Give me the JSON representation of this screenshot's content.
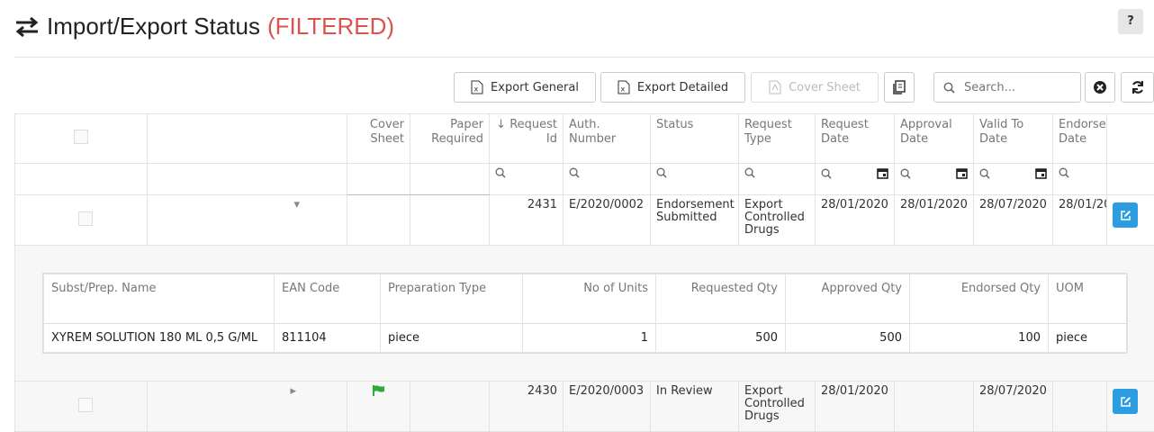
{
  "header": {
    "title": "Import/Export Status",
    "filter_label": "(FILTERED)",
    "help_label": "?"
  },
  "toolbar": {
    "export_general": "Export General",
    "export_detailed": "Export Detailed",
    "cover_sheet": "Cover Sheet",
    "search_placeholder": "Search..."
  },
  "columns": {
    "cover_sheet": "Cover Sheet",
    "paper_required": "Paper Required",
    "request_id": "Request Id",
    "auth_number": "Auth. Number",
    "status": "Status",
    "request_type": "Request Type",
    "request_date": "Request Date",
    "approval_date": "Approval Date",
    "valid_to_date": "Valid To Date",
    "endorsement_date": "Endorsen Date"
  },
  "rows": [
    {
      "request_id": "2431",
      "auth_number": "E/2020/0002",
      "status": "Endorsement Submitted",
      "request_type": "Export Controlled Drugs",
      "request_date": "28/01/2020",
      "approval_date": "28/01/2020",
      "valid_to_date": "28/07/2020",
      "endorsement_date": "28/01/20"
    },
    {
      "request_id": "2430",
      "auth_number": "E/2020/0003",
      "status": "In Review",
      "request_type": "Export Controlled Drugs",
      "request_date": "28/01/2020",
      "approval_date": "",
      "valid_to_date": "28/07/2020",
      "endorsement_date": ""
    }
  ],
  "detail": {
    "headers": {
      "name": "Subst/Prep. Name",
      "ean": "EAN Code",
      "prep_type": "Preparation Type",
      "units": "No of Units",
      "requested": "Requested Qty",
      "approved": "Approved Qty",
      "endorsed": "Endorsed Qty",
      "uom": "UOM"
    },
    "items": [
      {
        "name": "XYREM SOLUTION 180 ML 0,5 G/ML",
        "ean": "811104",
        "prep_type": "piece",
        "units": "1",
        "requested": "500",
        "approved": "500",
        "endorsed": "100",
        "uom": "piece"
      }
    ]
  },
  "colors": {
    "accent": "#2b9de0",
    "filtered": "#d9534f",
    "flag": "#2eaa3a"
  }
}
